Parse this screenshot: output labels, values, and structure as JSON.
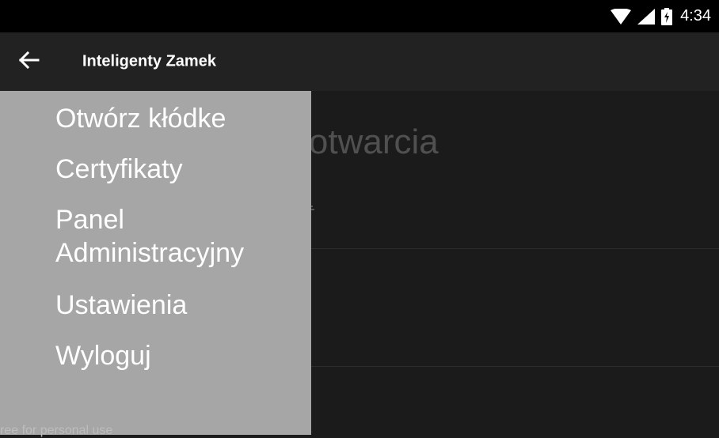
{
  "status_bar": {
    "time": "4:34",
    "icons": [
      "wifi-icon",
      "signal-icon",
      "battery-charging-icon"
    ]
  },
  "app_bar": {
    "title": "Inteligenty Zamek",
    "back_icon": "arrow-back-icon"
  },
  "main": {
    "heading": "zamków do otwarcia",
    "sort_label": "ortuj",
    "sort_icon": "sort-icon"
  },
  "drawer": {
    "items": [
      {
        "label": "Otwórz kłódke"
      },
      {
        "label": "Certyfikaty"
      },
      {
        "label": "Panel"
      },
      {
        "label": "Administracyjny"
      },
      {
        "label": "Ustawienia"
      },
      {
        "label": "Wyloguj"
      }
    ],
    "watermark": "ree for personal use"
  },
  "colors": {
    "drawer_bg": "#a6a6a6",
    "app_bar_bg": "#222222",
    "content_bg": "#1b1b1b"
  }
}
